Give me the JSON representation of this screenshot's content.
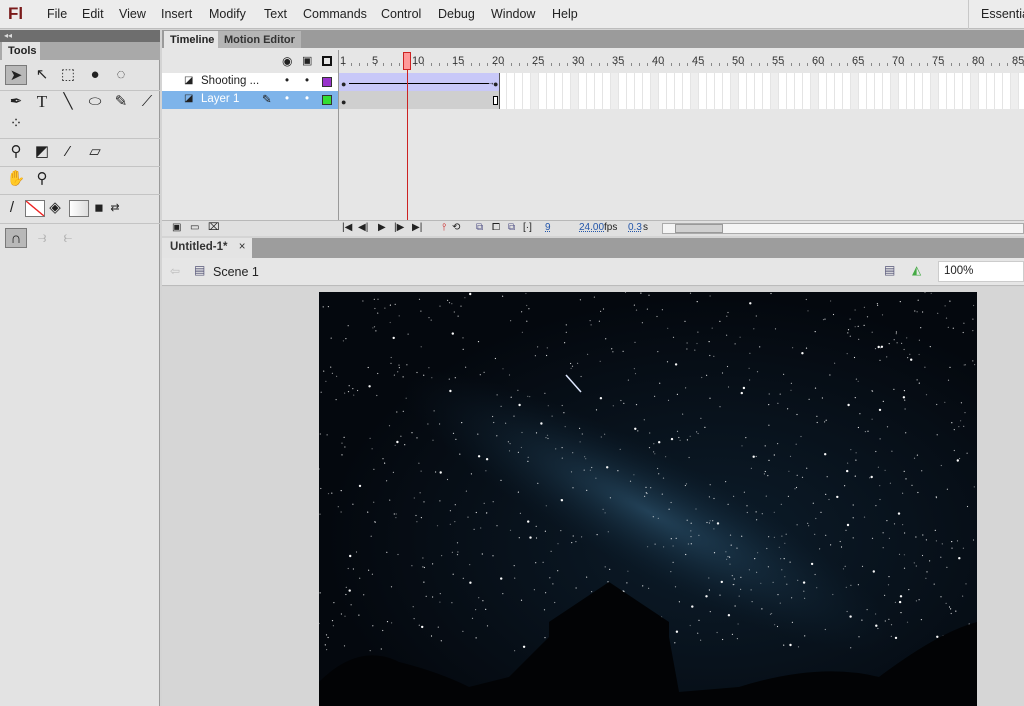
{
  "app": {
    "logo": "Fl",
    "workspace": "Essentials"
  },
  "menu": [
    "File",
    "Edit",
    "View",
    "Insert",
    "Modify",
    "Text",
    "Commands",
    "Control",
    "Debug",
    "Window",
    "Help"
  ],
  "tools_panel": {
    "collapse": "◂◂",
    "tab": "Tools"
  },
  "timeline": {
    "tabs": [
      "Timeline",
      "Motion Editor"
    ],
    "frame_labels": [
      "1",
      "5",
      "10",
      "15",
      "20",
      "25",
      "30",
      "35",
      "40",
      "45",
      "50",
      "55",
      "60",
      "65",
      "70",
      "75",
      "80",
      "85"
    ],
    "current_frame": 9,
    "layers": [
      {
        "name": "Shooting ...",
        "color": "#9933cc",
        "selected": false,
        "tween_end": 20
      },
      {
        "name": "Layer 1",
        "color": "#33dd33",
        "selected": true,
        "tween_end": 20
      }
    ],
    "status": {
      "frame": "9",
      "fps": "24.00",
      "fps_unit": "fps",
      "time": "0.3",
      "time_unit": "s"
    }
  },
  "document": {
    "tab": "Untitled-1*",
    "close": "×",
    "scene": "Scene 1",
    "zoom": "100%"
  },
  "colors": {
    "playhead": "#cc2222",
    "selection": "#7eb4ea",
    "tween": "#c8c8f8"
  }
}
